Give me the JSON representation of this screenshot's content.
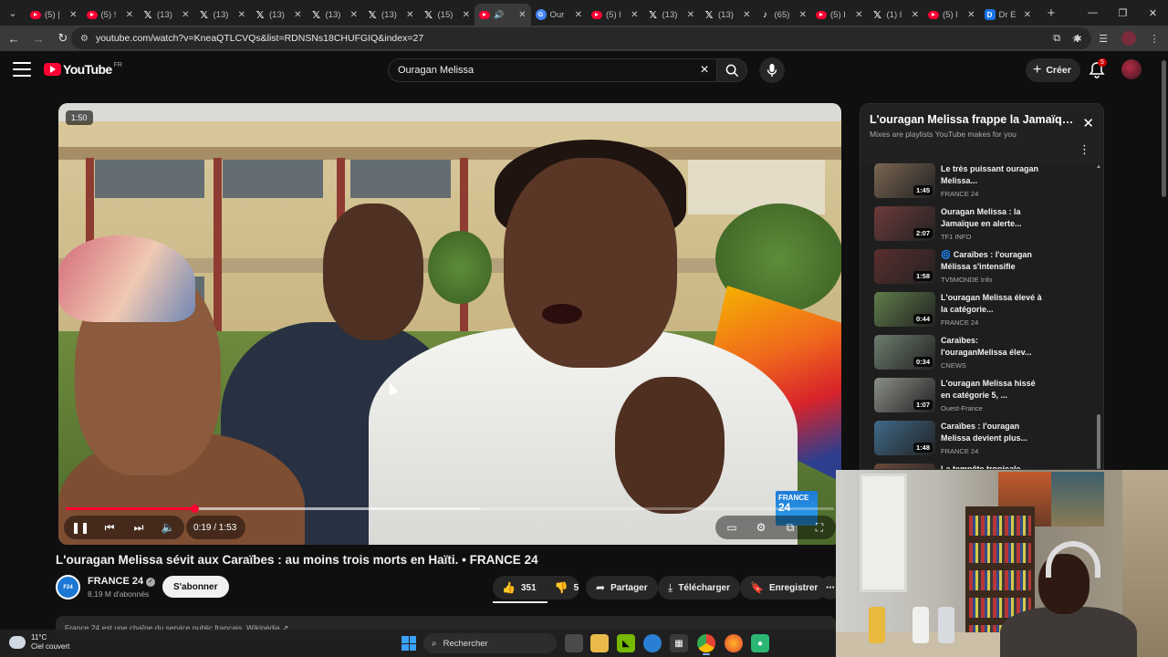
{
  "browser": {
    "tabs": [
      {
        "icon": "youtube",
        "title": "(5) |",
        "active": false
      },
      {
        "icon": "youtube",
        "title": "(5) !",
        "active": false
      },
      {
        "icon": "x",
        "title": "(13)",
        "active": false
      },
      {
        "icon": "x",
        "title": "(13)",
        "active": false
      },
      {
        "icon": "x",
        "title": "(13)",
        "active": false
      },
      {
        "icon": "x",
        "title": "(13)",
        "active": false
      },
      {
        "icon": "x",
        "title": "(13)",
        "active": false
      },
      {
        "icon": "x",
        "title": "(15)",
        "active": false
      },
      {
        "icon": "youtube-audio",
        "title": "",
        "active": true
      },
      {
        "icon": "google",
        "title": "Our",
        "active": false
      },
      {
        "icon": "youtube",
        "title": "(5) l",
        "active": false
      },
      {
        "icon": "x",
        "title": "(13)",
        "active": false
      },
      {
        "icon": "x",
        "title": "(13)",
        "active": false
      },
      {
        "icon": "tiktok",
        "title": "(65)",
        "active": false
      },
      {
        "icon": "youtube",
        "title": "(5) I",
        "active": false
      },
      {
        "icon": "x",
        "title": "(1) I",
        "active": false
      },
      {
        "icon": "youtube",
        "title": "(5) l",
        "active": false
      },
      {
        "icon": "d",
        "title": "Dr E",
        "active": false
      }
    ],
    "url": "youtube.com/watch?v=KneaQTLCVQs&list=RDNSNs18CHUFGIQ&index=27"
  },
  "youtube": {
    "logo_text": "YouTube",
    "country": "FR",
    "search_value": "Ouragan Melissa",
    "create_label": "Créer",
    "notification_count": "5"
  },
  "video": {
    "badge": "1:50",
    "current_time": "0:19",
    "duration": "1:53",
    "time_display": "0:19 / 1:53",
    "progress_fraction": 0.168,
    "buffer_fraction": 0.54,
    "watermark_line1": "FRANCE",
    "watermark_line2": "24",
    "title": "L'ouragan Melissa sévit aux Caraïbes : au moins trois morts en Haïti. • FRANCE 24",
    "channel": "FRANCE 24",
    "subscribers": "8,19 M d'abonnés",
    "subscribe_label": "S'abonner",
    "likes": "351",
    "dislikes": "5",
    "share_label": "Partager",
    "download_label": "Télécharger",
    "save_label": "Enregistrer",
    "description_preview": "France 24 est une chaîne du service public français. Wikipédia ↗"
  },
  "playlist": {
    "title": "L'ouragan Melissa frappe la Jamaïque...",
    "subtitle": "Mixes are playlists YouTube makes for you",
    "items": [
      {
        "title": "Le très puissant ouragan Melissa...",
        "channel": "FRANCE 24",
        "duration": "1:45",
        "thumb": "#7a6652"
      },
      {
        "title": "Ouragan Melissa : la Jamaïque en alerte...",
        "channel": "TF1 INFO",
        "duration": "2:07",
        "thumb": "#6d3b3b"
      },
      {
        "title": "🌀 Caraïbes : l'ouragan Mélissa s'intensifie",
        "channel": "TV5MONDE Info",
        "duration": "1:58",
        "thumb": "#5b2e2e"
      },
      {
        "title": "L'ouragan Melissa élevé à la catégorie...",
        "channel": "FRANCE 24",
        "duration": "0:44",
        "thumb": "#5f7d4a"
      },
      {
        "title": "Caraïbes: l'ouraganMelissa élev...",
        "channel": "CNEWS",
        "duration": "0:34",
        "thumb": "#6d7d6e"
      },
      {
        "title": "L'ouragan Melissa hissé en catégorie 5, ...",
        "channel": "Ouest-France",
        "duration": "1:07",
        "thumb": "#8a8e87"
      },
      {
        "title": "Caraïbes : l'ouragan Melissa devient plus...",
        "channel": "FRANCE 24",
        "duration": "1:48",
        "thumb": "#3f6a8a"
      },
      {
        "title": "La tempête tropicale",
        "channel": "",
        "duration": "",
        "thumb": "#6a4a3c"
      }
    ]
  },
  "taskbar": {
    "temperature": "11°C",
    "weather": "Ciel couvert",
    "search_label": "Rechercher"
  }
}
